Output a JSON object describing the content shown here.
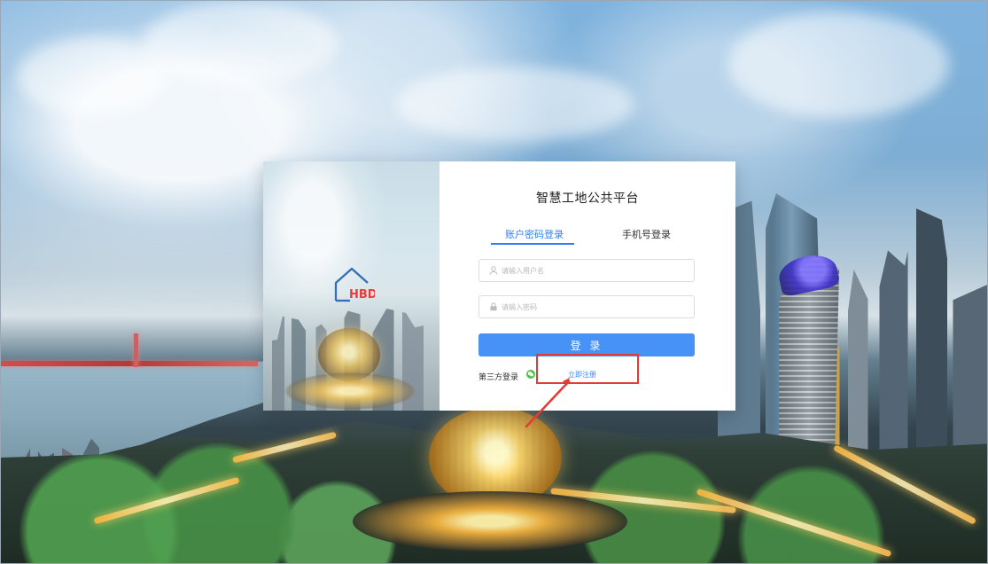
{
  "login": {
    "title": "智慧工地公共平台",
    "tabs": [
      {
        "label": "账户密码登录"
      },
      {
        "label": "手机号登录"
      }
    ],
    "username_placeholder": "请输入用户名",
    "password_placeholder": "请输入密码",
    "submit_label": "登 录",
    "third_party_label": "第三方登录",
    "register_label": "立即注册"
  },
  "logo": {
    "text": "HBD"
  },
  "colors": {
    "accent": "#4792f7",
    "tab_active": "#2f7ff6",
    "highlight": "#e33b35"
  },
  "icons": {
    "logo": "house-logo-icon",
    "username": "user-icon",
    "password": "lock-icon",
    "third_party": "wechat-icon",
    "annotation": "arrow-icon"
  }
}
